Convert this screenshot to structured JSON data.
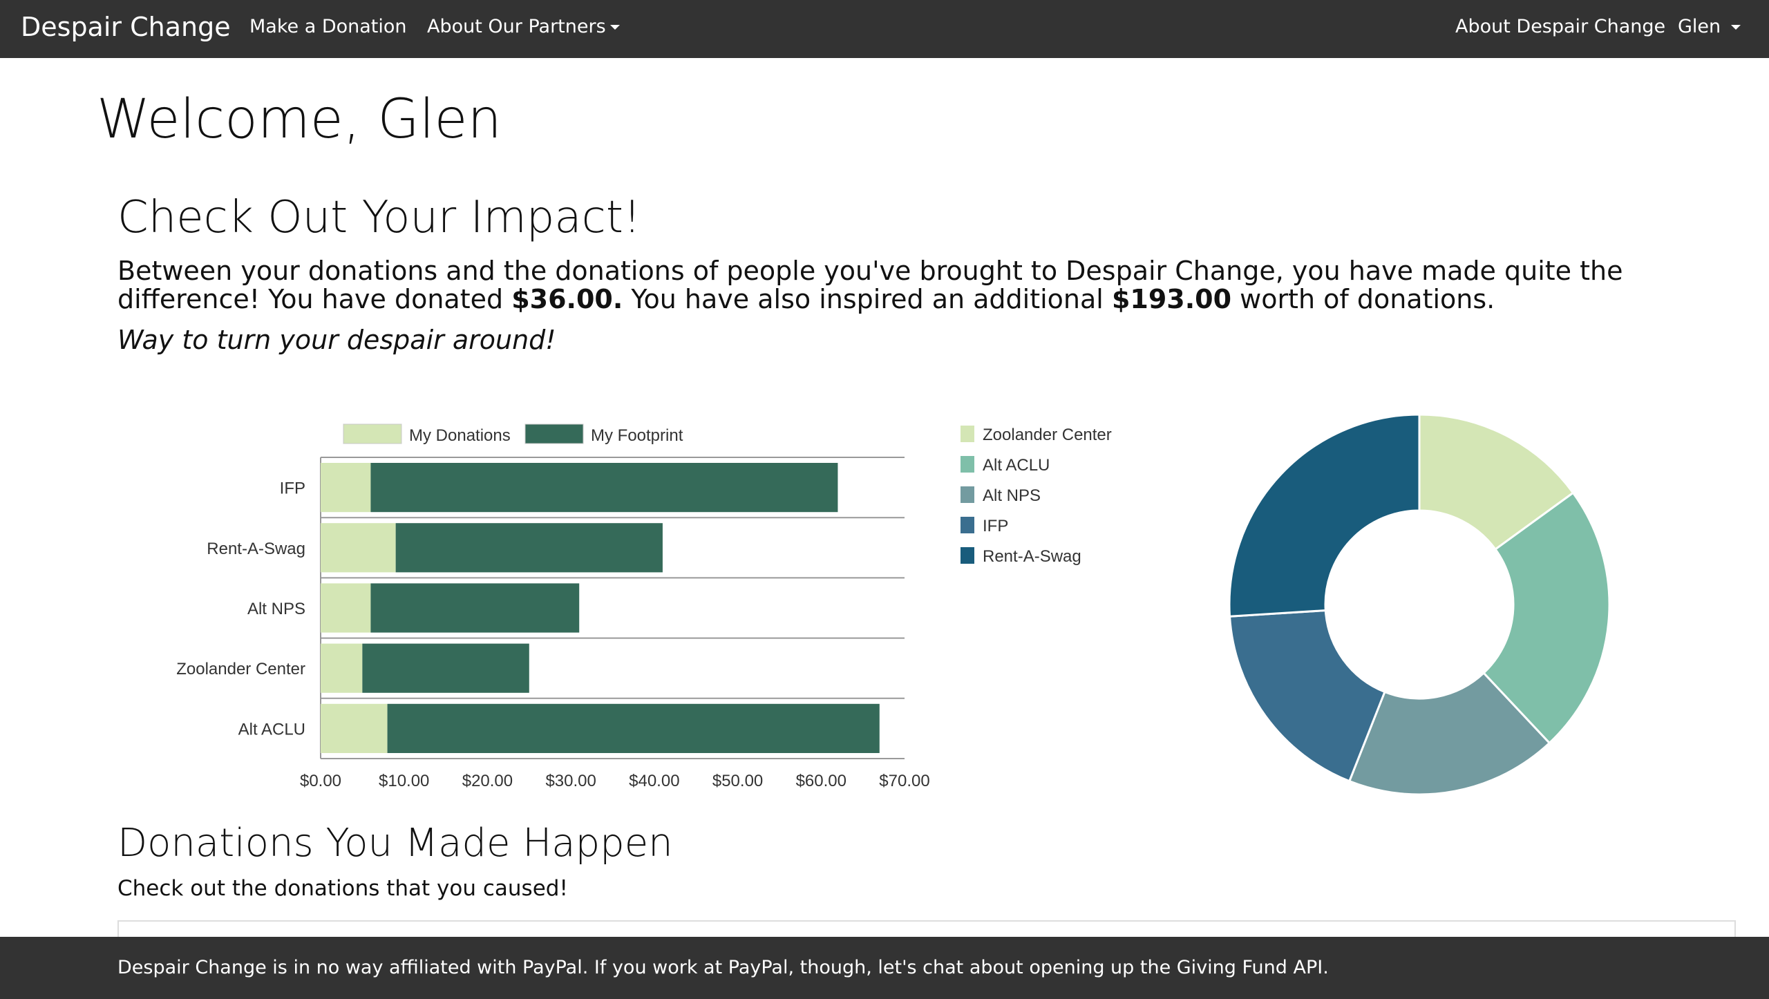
{
  "nav": {
    "brand": "Despair Change",
    "make_donation": "Make a Donation",
    "about_partners": "About Our Partners",
    "about_app": "About Despair Change",
    "user": "Glen"
  },
  "welcome": "Welcome, Glen",
  "impact": {
    "title": "Check Out Your Impact!",
    "intro": "Between your donations and the donations of people you've brought to Despair Change, you have made quite the difference! You have donated ",
    "donated": "$36.00.",
    "mid": " You have also inspired an additional ",
    "inspired": "$193.00",
    "end": " worth of donations.",
    "tagline": "Way to turn your despair around!"
  },
  "donations_section": {
    "title": "Donations You Made Happen",
    "subtitle": "Check out the donations that you caused!"
  },
  "footer": "Despair Change is in no way affiliated with PayPal. If you work at PayPal, though, let's chat about opening up the Giving Fund API.",
  "colors": {
    "nav_bg": "#333333",
    "my_donations": "#d4e6b5",
    "my_footprint": "#356a59",
    "pie": [
      "#d4e6b5",
      "#7fbfa9",
      "#739ba0",
      "#3a6e8f",
      "#195c7c"
    ]
  },
  "chart_data": [
    {
      "type": "bar",
      "orientation": "horizontal",
      "stacked": true,
      "categories": [
        "IFP",
        "Rent-A-Swag",
        "Alt NPS",
        "Zoolander Center",
        "Alt ACLU"
      ],
      "series": [
        {
          "name": "My Donations",
          "values": [
            6,
            9,
            6,
            5,
            8
          ]
        },
        {
          "name": "My Footprint",
          "values": [
            56,
            32,
            25,
            20,
            59
          ]
        }
      ],
      "xlim": [
        0,
        70
      ],
      "xticks": [
        "$0.00",
        "$10.00",
        "$20.00",
        "$30.00",
        "$40.00",
        "$50.00",
        "$60.00",
        "$70.00"
      ],
      "legend": "top",
      "grid": false
    },
    {
      "type": "pie",
      "donut": true,
      "labels": [
        "Zoolander Center",
        "Alt ACLU",
        "Alt NPS",
        "IFP",
        "Rent-A-Swag"
      ],
      "values": [
        15,
        23,
        18,
        18,
        26
      ],
      "legend": "left"
    }
  ]
}
